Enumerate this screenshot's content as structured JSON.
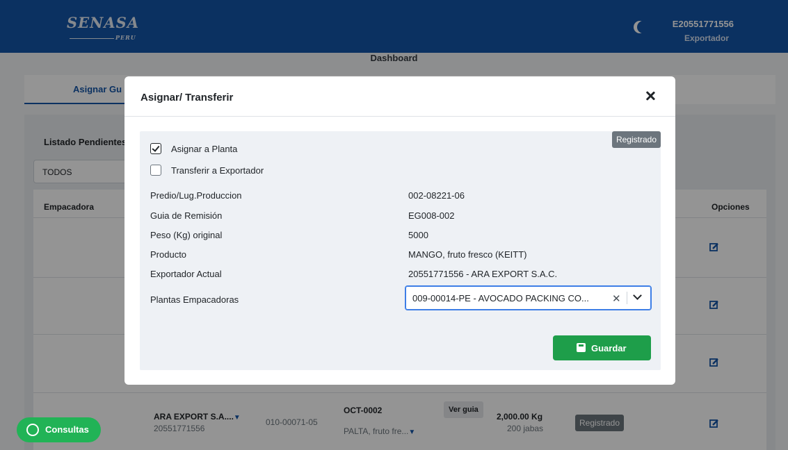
{
  "header": {
    "logo_text": "SENASA",
    "logo_sub": "PERU",
    "user_id": "E20551771556",
    "user_role": "Exportador"
  },
  "page": {
    "title": "Dashboard",
    "tab_active": "Asignar Gu",
    "panel_title": "Listado Pendientes",
    "filter_value": "TODOS",
    "columns": {
      "empacadora": "Empacadora",
      "opciones": "Opciones"
    },
    "visible_row": {
      "exportador": "ARA EXPORT S.A....",
      "ruc": "20551771556",
      "predio": "010-00071-05",
      "guia": "OCT-0002",
      "producto": "PALTA, fruto fre...",
      "ver_guia": "Ver guia",
      "peso": "2,000.00 Kg",
      "jabas": "200 jabas",
      "estado": "Registrado"
    },
    "consultas_label": "Consultas"
  },
  "modal": {
    "title": "Asignar/ Transferir",
    "status_badge": "Registrado",
    "checkbox_planta": {
      "label": "Asignar a Planta",
      "checked": true
    },
    "checkbox_exportador": {
      "label": "Transferir a Exportador",
      "checked": false
    },
    "fields": [
      {
        "label": "Predio/Lug.Produccion",
        "value": "002-08221-06"
      },
      {
        "label": "Guia de Remisión",
        "value": "EG008-002"
      },
      {
        "label": "Peso (Kg) original",
        "value": "5000"
      },
      {
        "label": "Producto",
        "value": "MANGO, fruto fresco (KEITT)"
      },
      {
        "label": "Exportador Actual",
        "value": "20551771556 - ARA EXPORT S.A.C."
      }
    ],
    "plantas_label": "Plantas Empacadoras",
    "plantas_value": "009-00014-PE - AVOCADO PACKING CO...",
    "save_label": "Guardar"
  }
}
